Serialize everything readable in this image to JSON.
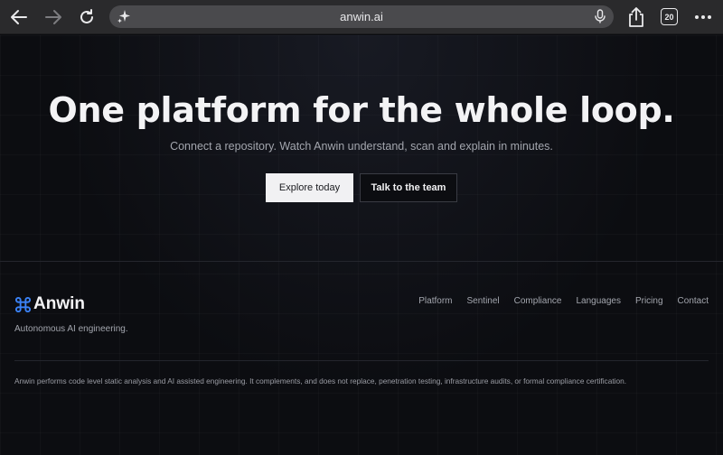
{
  "browser": {
    "url": "anwin.ai",
    "tab_count": "20"
  },
  "hero": {
    "title": "One platform for the whole loop.",
    "subtitle": "Connect a repository. Watch Anwin understand, scan and explain in minutes.",
    "primary_button": "Explore today",
    "secondary_button": "Talk to the team"
  },
  "footer": {
    "brand_name": "Anwin",
    "tagline": "Autonomous AI engineering.",
    "nav": [
      "Platform",
      "Sentinel",
      "Compliance",
      "Languages",
      "Pricing",
      "Contact"
    ],
    "disclaimer": "Anwin performs code level static analysis and AI assisted engineering. It complements, and does not replace, penetration testing, infrastructure audits, or formal compliance certification."
  },
  "colors": {
    "brand_accent": "#3b82f6",
    "background": "#0c0d11"
  }
}
